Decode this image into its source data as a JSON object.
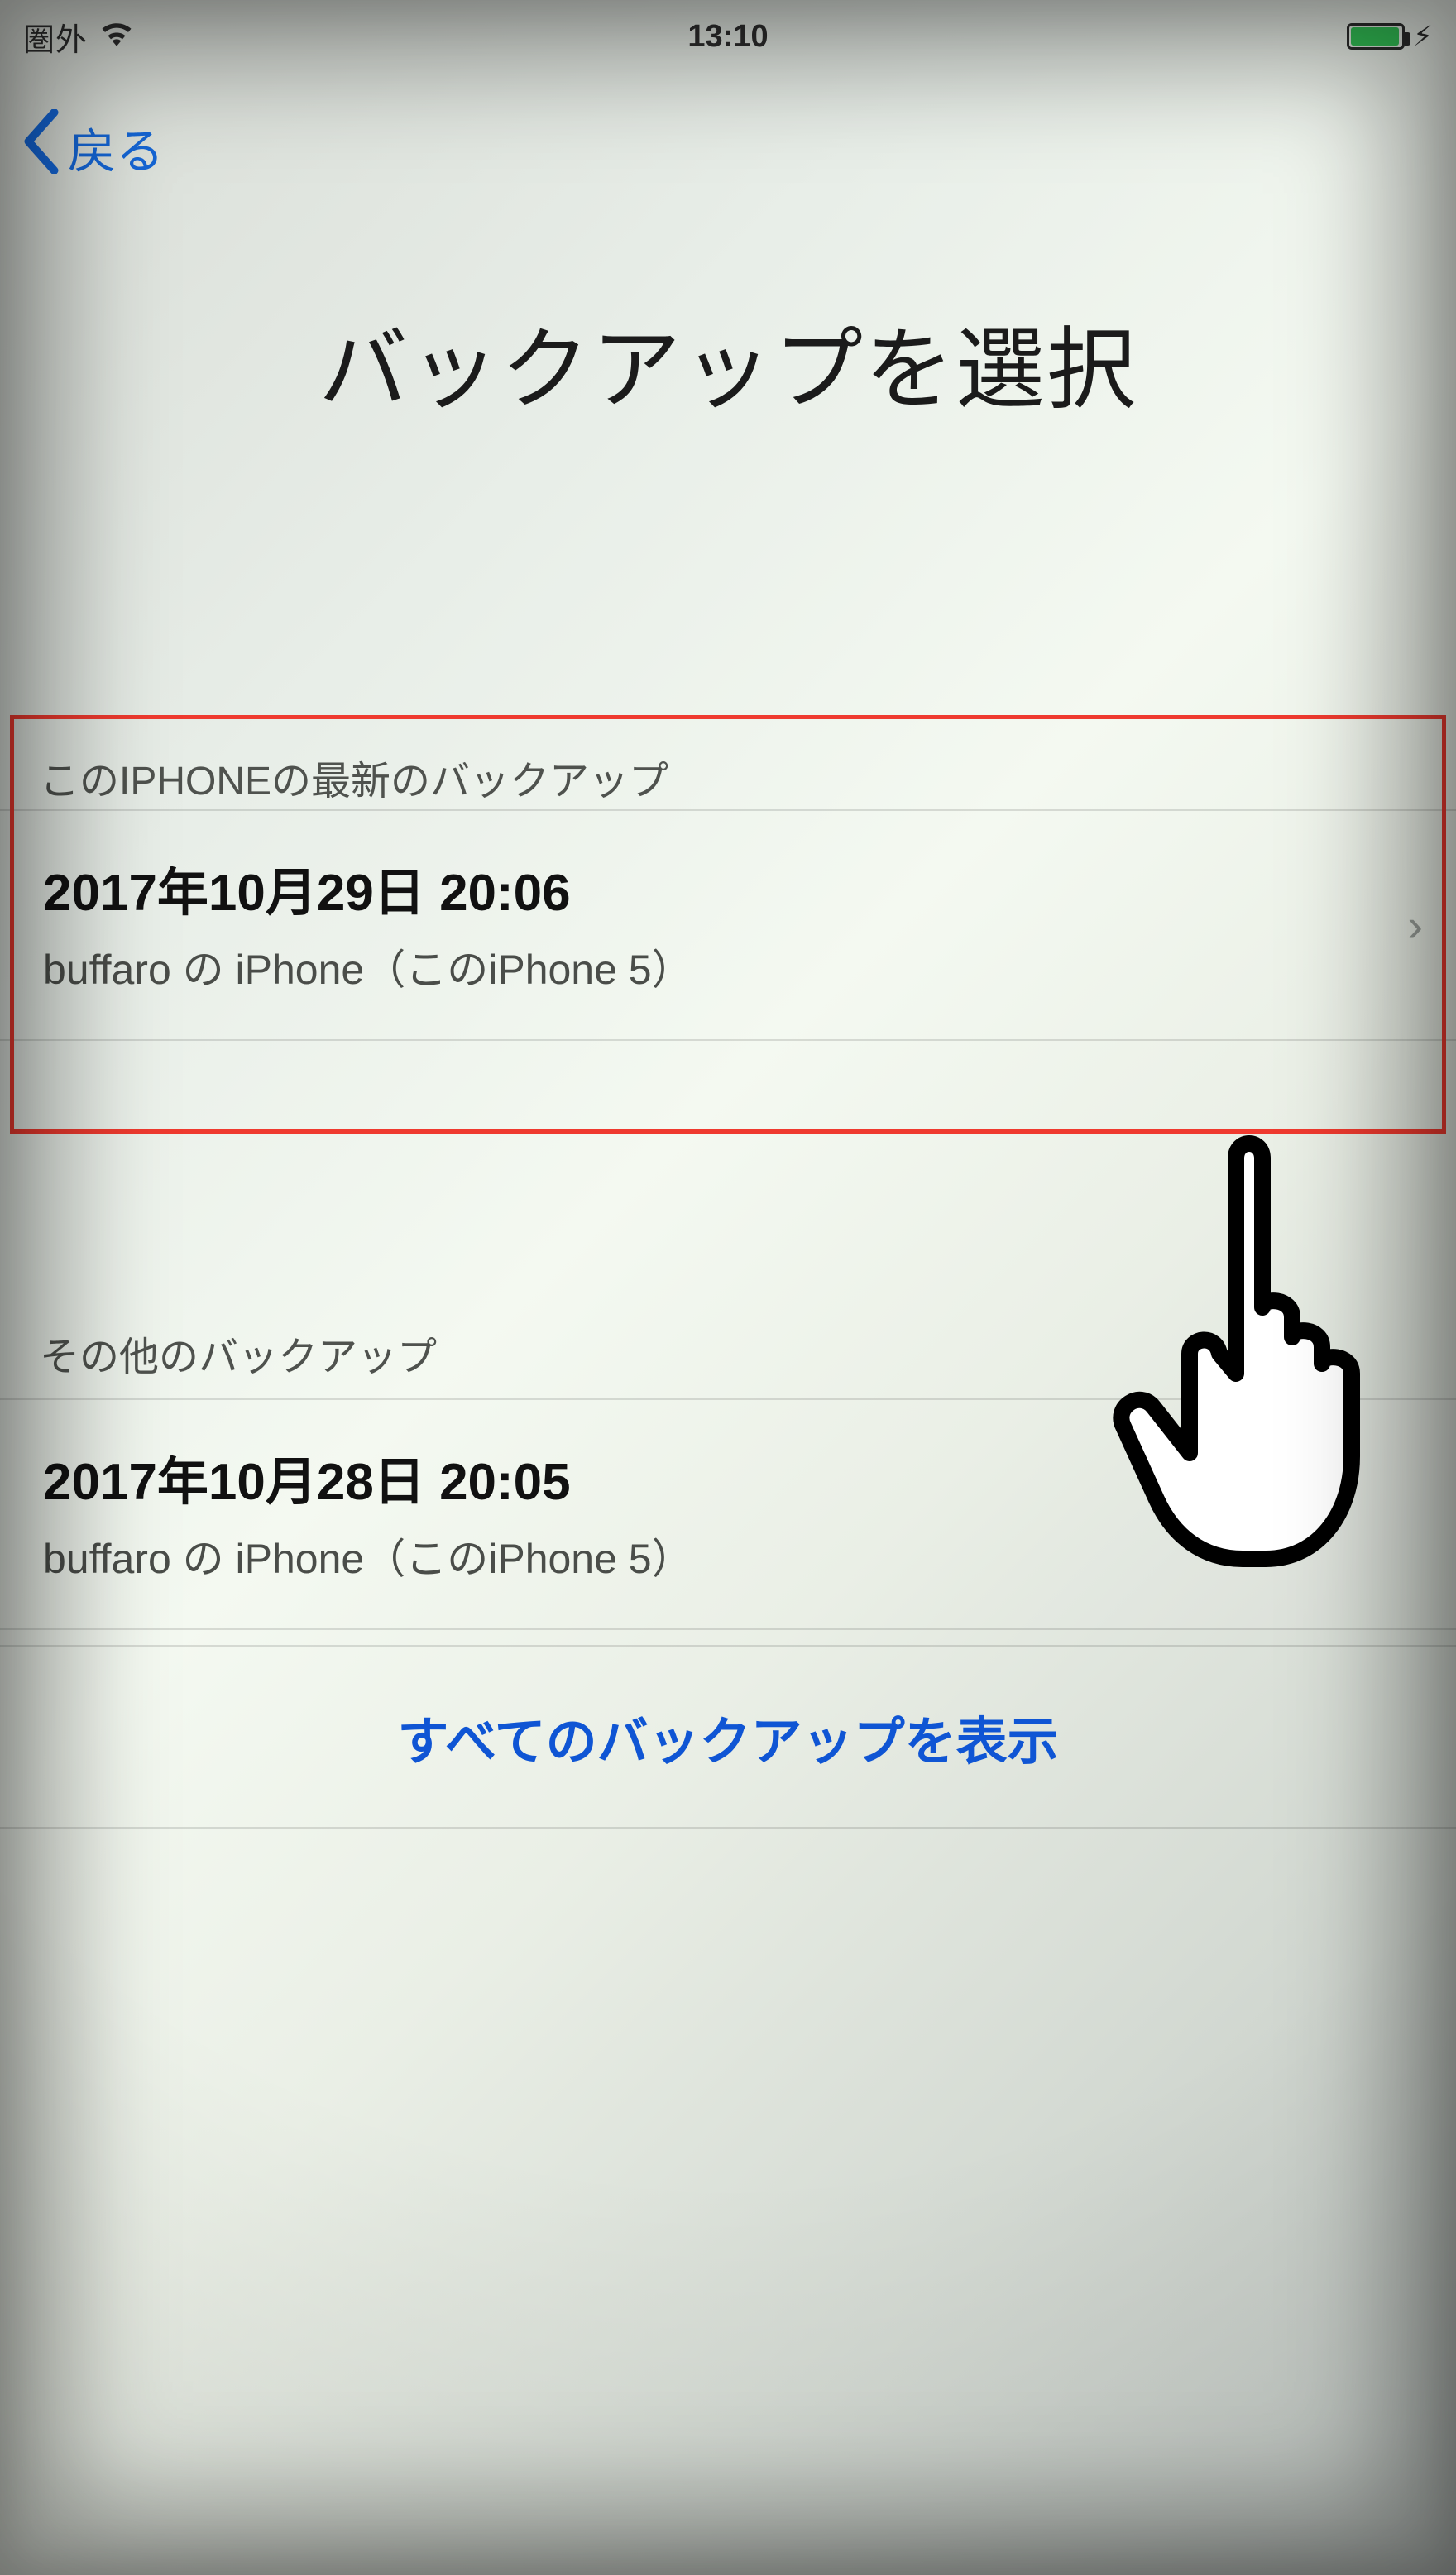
{
  "status": {
    "carrier": "圏外",
    "time": "13:10"
  },
  "nav": {
    "back_label": "戻る"
  },
  "title": "バックアップを選択",
  "sections": {
    "latest": {
      "header": "このIPHONEの最新のバックアップ",
      "item": {
        "datetime": "2017年10月29日 20:06",
        "device": "buffaro の iPhone（このiPhone 5）"
      }
    },
    "other": {
      "header": "その他のバックアップ",
      "item": {
        "datetime": "2017年10月28日 20:05",
        "device": "buffaro の iPhone（このiPhone 5）"
      }
    }
  },
  "show_all": "すべてのバックアップを表示"
}
